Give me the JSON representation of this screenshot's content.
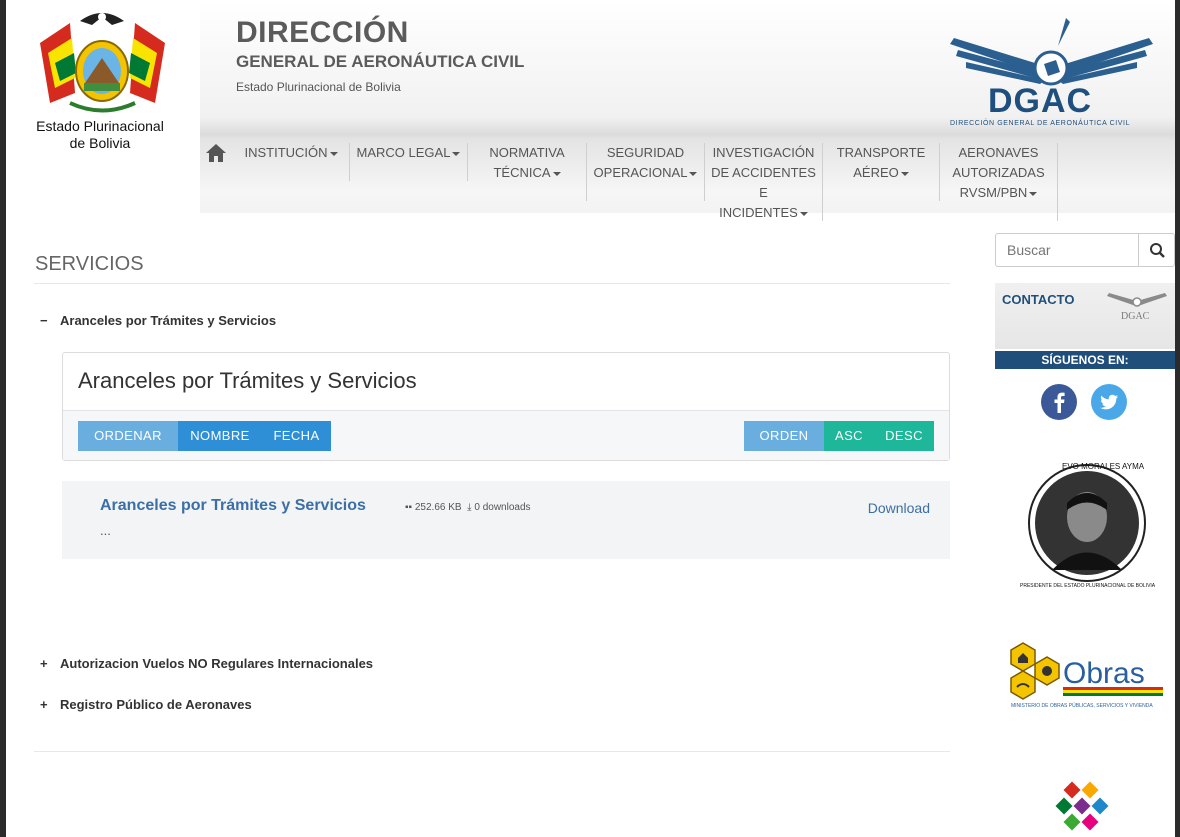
{
  "header": {
    "seal_caption_line1": "Estado Plurinacional",
    "seal_caption_line2": "de Bolivia",
    "title_main": "DIRECCIÓN",
    "title_sub": "GENERAL DE AERONÁUTICA CIVIL",
    "title_state": "Estado Plurinacional de Bolivia",
    "logo_text": "DGAC",
    "logo_subtext": "DIRECCIÓN GENERAL DE AERONÁUTICA CIVIL"
  },
  "nav": {
    "home_icon": "home-icon",
    "items": [
      {
        "line1": "INSTITUCIÓN",
        "line2": "",
        "line3": ""
      },
      {
        "line1": "MARCO LEGAL",
        "line2": "",
        "line3": ""
      },
      {
        "line1": "NORMATIVA",
        "line2": "TÉCNICA",
        "line3": ""
      },
      {
        "line1": "SEGURIDAD",
        "line2": "OPERACIONAL",
        "line3": ""
      },
      {
        "line1": "INVESTIGACIÓN",
        "line2": "DE ACCIDENTES E",
        "line3": "INCIDENTES"
      },
      {
        "line1": "TRANSPORTE",
        "line2": "AÉREO",
        "line3": ""
      },
      {
        "line1": "AERONAVES",
        "line2": "AUTORIZADAS",
        "line3": "RVSM/PBN"
      }
    ]
  },
  "main": {
    "section_title": "SERVICIOS",
    "accordion": [
      {
        "icon": "−",
        "label": "Aranceles por Trámites y Servicios",
        "expanded": true
      },
      {
        "icon": "+",
        "label": "Autorizacion Vuelos NO Regulares Internacionales",
        "expanded": false
      },
      {
        "icon": "+",
        "label": "Registro Público de Aeronaves",
        "expanded": false
      }
    ],
    "panel_title": "Aranceles por Trámites y Servicios",
    "sort": {
      "ordenar": "ORDENAR",
      "nombre": "NOMBRE",
      "fecha": "FECHA",
      "orden": "ORDEN",
      "asc": "ASC",
      "desc": "DESC"
    },
    "file": {
      "title": "Aranceles por Trámites y Servicios",
      "size": "252.66 KB",
      "downloads": "0 downloads",
      "excerpt": "...",
      "download_label": "Download"
    }
  },
  "sidebar": {
    "search_placeholder": "Buscar",
    "contact_label": "CONTACTO",
    "contact_logo_text": "DGAC",
    "follow_label": "SÍGUENOS EN:",
    "president_top": "EVO MORALES AYMA",
    "president_bottom": "PRESIDENTE DEL ESTADO PLURINACIONAL DE BOLIVIA",
    "obras_label": "Obras",
    "obras_sub": "MINISTERIO DE OBRAS PÚBLICAS, SERVICIOS Y VIVIENDA"
  },
  "colors": {
    "brand_blue": "#1e4e79",
    "link_blue": "#3b6fa6",
    "btn_light_blue": "#6aaee0",
    "btn_blue": "#2f8fd6",
    "btn_green": "#1fb79a"
  }
}
